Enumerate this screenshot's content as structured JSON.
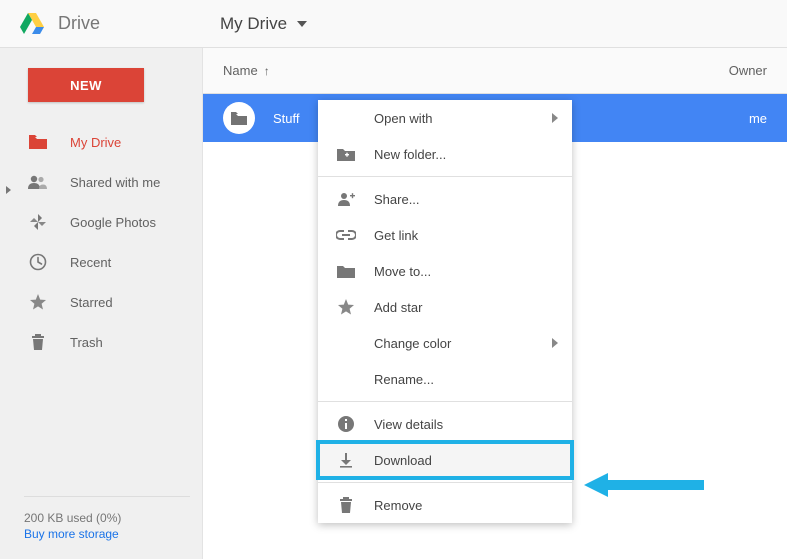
{
  "header": {
    "app_name": "Drive",
    "location": "My Drive"
  },
  "new_button": "NEW",
  "sidebar": {
    "items": [
      {
        "label": "My Drive",
        "icon": "folder-red",
        "active": true
      },
      {
        "label": "Shared with me",
        "icon": "people"
      },
      {
        "label": "Google Photos",
        "icon": "photos"
      },
      {
        "label": "Recent",
        "icon": "clock"
      },
      {
        "label": "Starred",
        "icon": "star"
      },
      {
        "label": "Trash",
        "icon": "trash"
      }
    ]
  },
  "storage": {
    "used_text": "200 KB used (0%)",
    "buy_text": "Buy more storage"
  },
  "columns": {
    "name": "Name",
    "owner": "Owner"
  },
  "row": {
    "name": "Stuff",
    "owner": "me"
  },
  "context_menu": {
    "open_with": "Open with",
    "new_folder": "New folder...",
    "share": "Share...",
    "get_link": "Get link",
    "move_to": "Move to...",
    "add_star": "Add star",
    "change_color": "Change color",
    "rename": "Rename...",
    "view_details": "View details",
    "download": "Download",
    "remove": "Remove"
  }
}
